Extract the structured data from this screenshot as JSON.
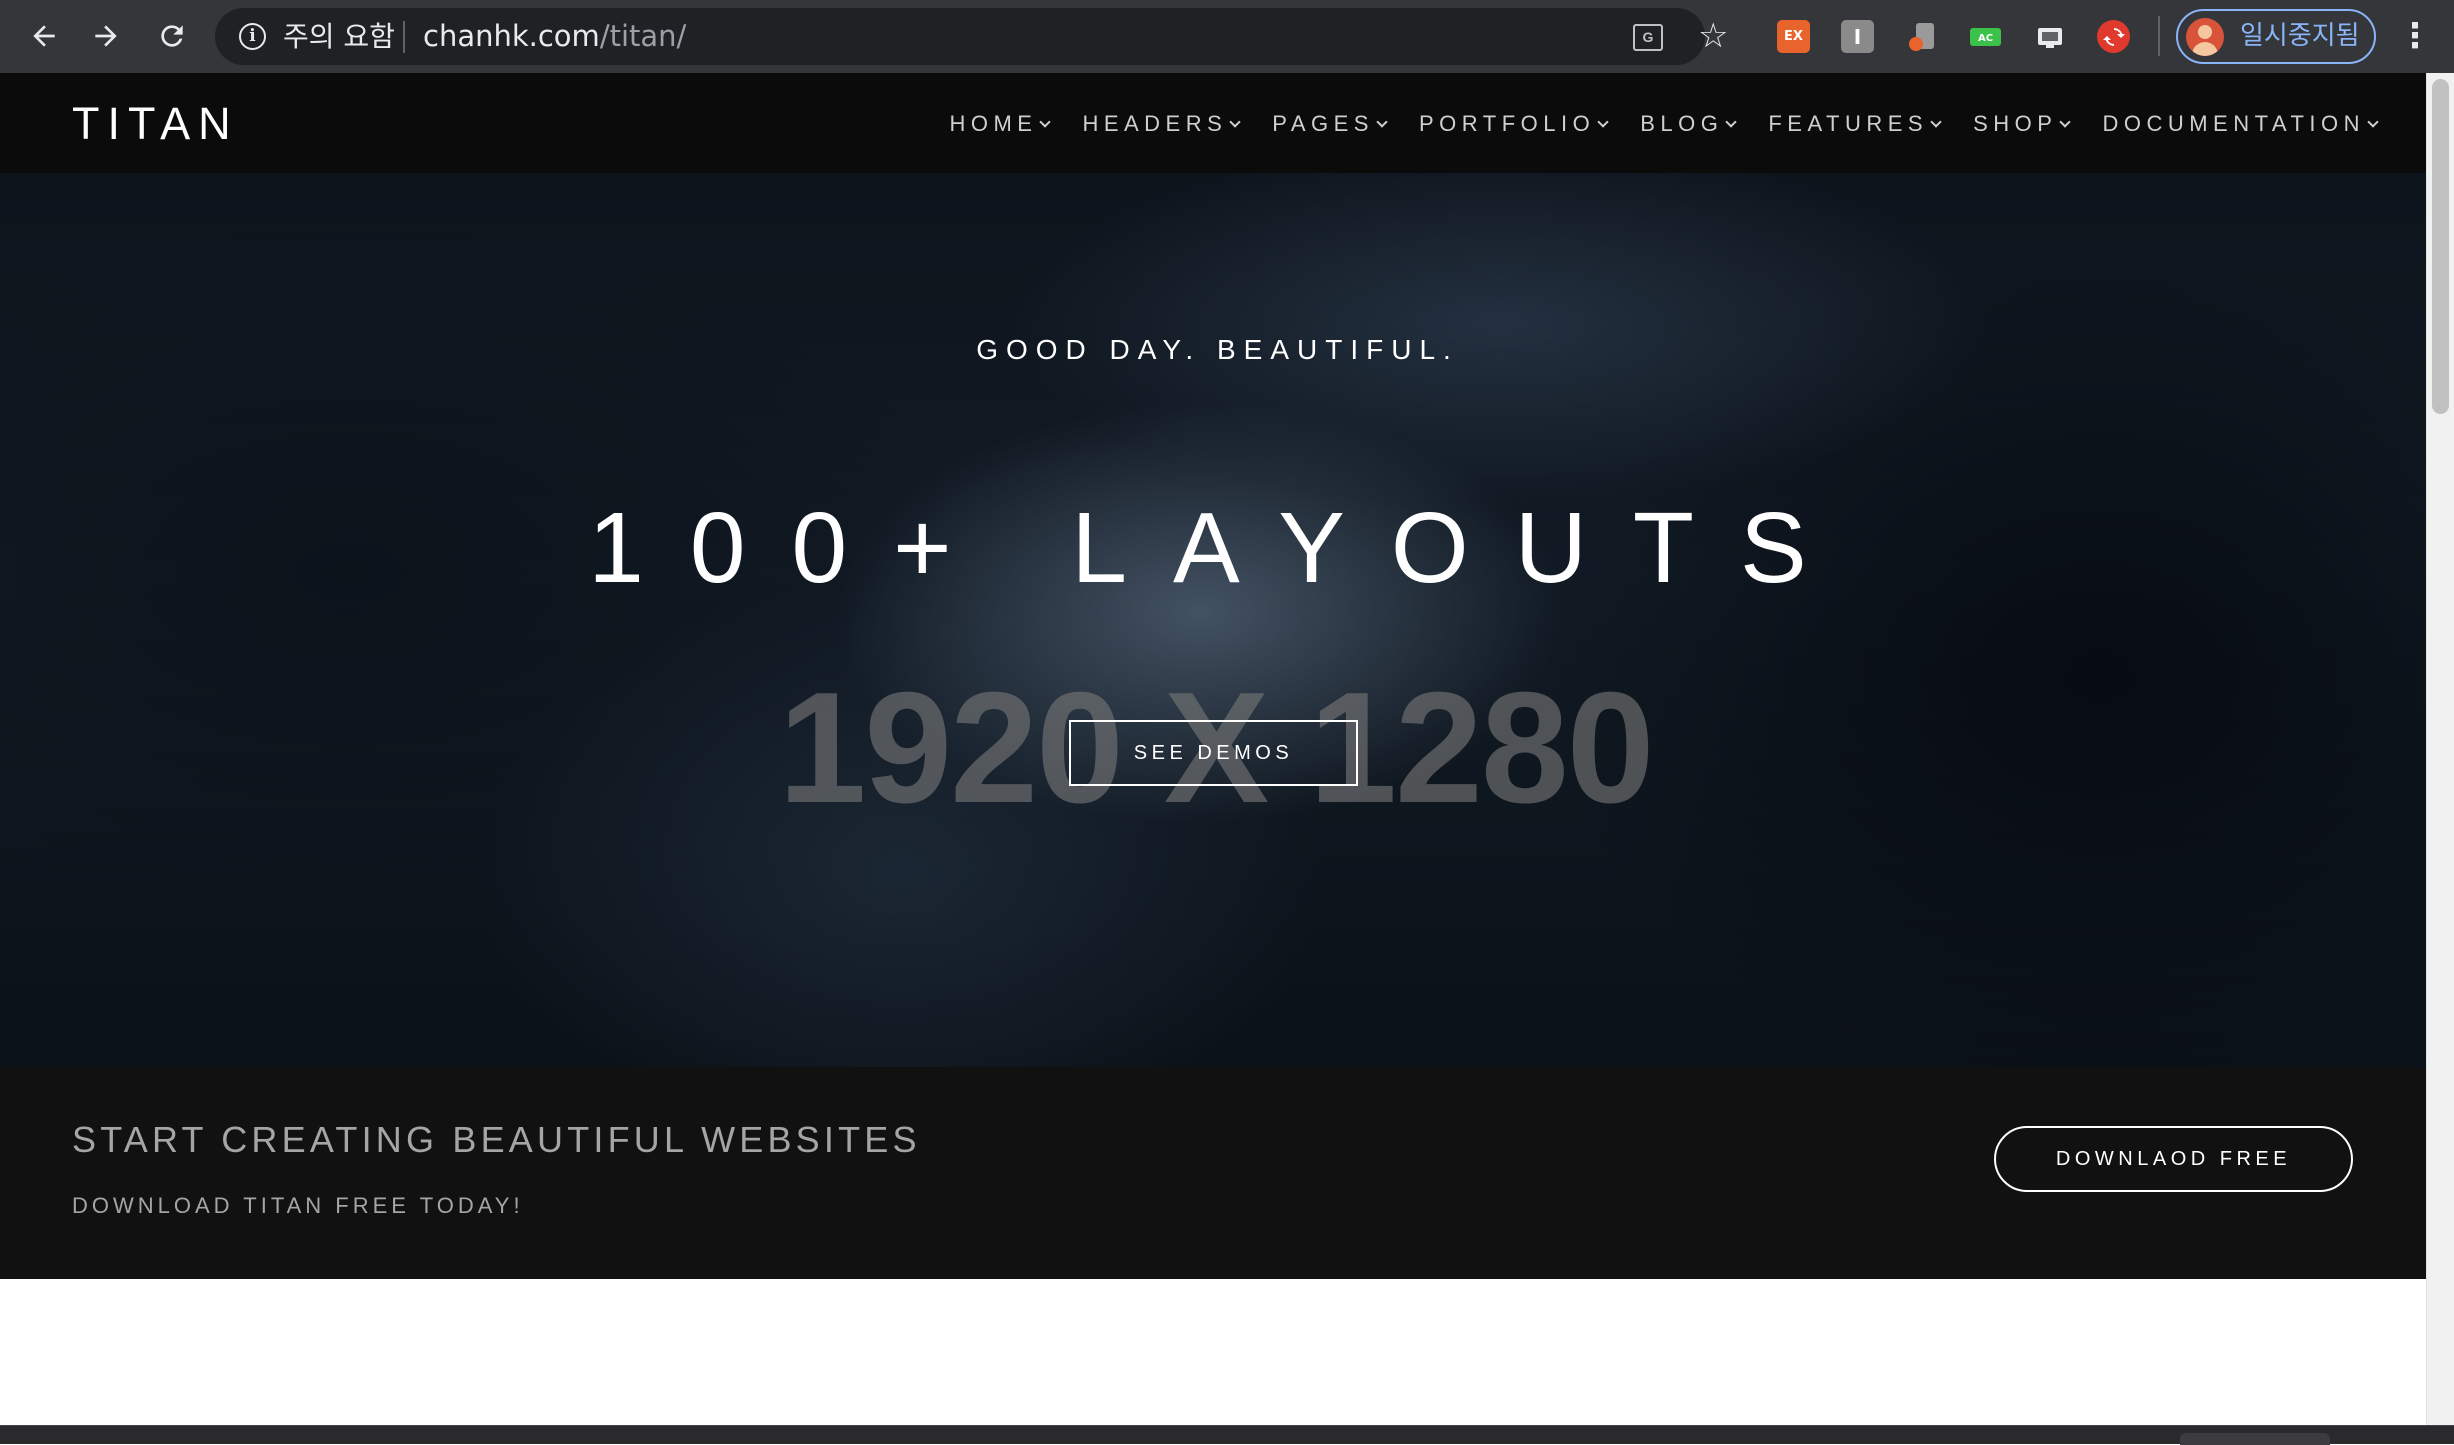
{
  "browser": {
    "omnibox": {
      "security_warning": "주의 요함",
      "url_host": "chanhk.com",
      "url_path": "/titan/"
    },
    "extensions": [
      "ex-extension-icon",
      "i-extension-icon",
      "audio-extension-icon",
      "ac-extension-icon",
      "screen-extension-icon",
      "sync-extension-icon"
    ],
    "extension_labels": {
      "e1": "EX",
      "e2": "I",
      "e4": "AC"
    },
    "profile": {
      "label": "일시중지됨"
    }
  },
  "site": {
    "logo": "TITAN",
    "nav": [
      {
        "label": "HOME"
      },
      {
        "label": "HEADERS"
      },
      {
        "label": "PAGES"
      },
      {
        "label": "PORTFOLIO"
      },
      {
        "label": "BLOG"
      },
      {
        "label": "FEATURES"
      },
      {
        "label": "SHOP"
      },
      {
        "label": "DOCUMENTATION"
      }
    ],
    "hero": {
      "tagline": "GOOD DAY. BEAUTIFUL.",
      "title": "100+ LAYOUTS",
      "watermark": "1920 X 1280",
      "button": "SEE DEMOS"
    },
    "cta": {
      "heading": "START CREATING BEAUTIFUL WEBSITES",
      "subheading": "DOWNLOAD TITAN FREE TODAY!",
      "button": "DOWNLAOD FREE"
    }
  },
  "colors": {
    "chrome_bg": "#35363a",
    "omnibox_bg": "#202124",
    "profile_accent": "#8ab4f8",
    "nav_bg": "#0b0b0c",
    "cta_bg": "#111111",
    "cta_text": "#a5a5a5"
  }
}
